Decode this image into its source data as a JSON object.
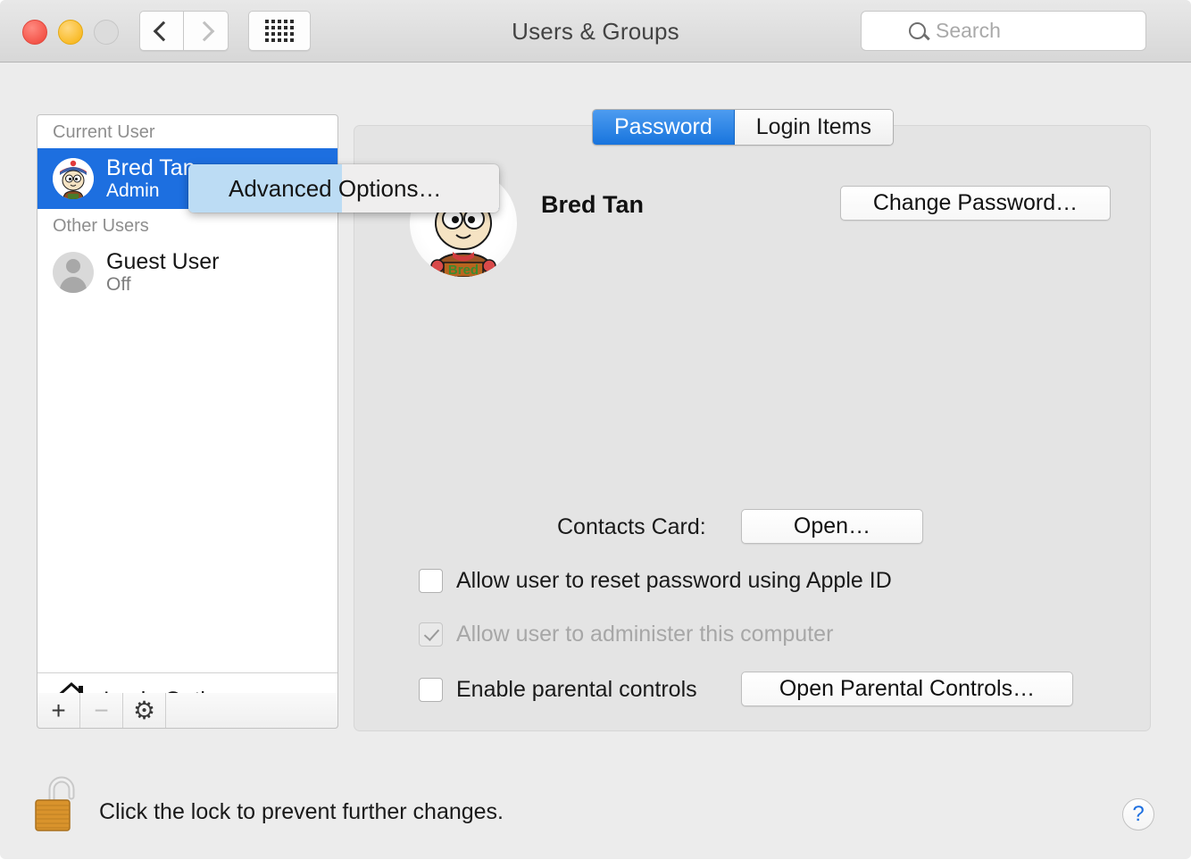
{
  "window": {
    "title": "Users & Groups",
    "traffic_lights": [
      "close",
      "minimize",
      "zoom"
    ]
  },
  "toolbar": {
    "back_icon": "chevron-left-icon",
    "forward_icon": "chevron-right-icon",
    "grid_icon": "show-all-grid-icon",
    "search": {
      "placeholder": "Search",
      "value": "",
      "icon": "search-icon"
    }
  },
  "sidebar": {
    "groups": [
      {
        "header": "Current User",
        "users": [
          {
            "name": "Bred Tan",
            "status": "Admin",
            "selected": true,
            "avatar": "bred-cartoon-avatar"
          }
        ]
      },
      {
        "header": "Other Users",
        "users": [
          {
            "name": "Guest User",
            "status": "Off",
            "selected": false,
            "avatar": "generic-person-avatar"
          }
        ]
      }
    ],
    "login_options": {
      "label": "Login Options",
      "icon": "home-icon"
    },
    "toolbar_buttons": [
      {
        "name": "add-user",
        "glyph": "+",
        "enabled": true
      },
      {
        "name": "remove-user",
        "glyph": "−",
        "enabled": false
      },
      {
        "name": "settings",
        "glyph": "⚙",
        "enabled": true
      }
    ]
  },
  "context_menu": {
    "items": [
      {
        "label": "Advanced Options…",
        "highlighted": true
      }
    ]
  },
  "main": {
    "tabs": [
      {
        "label": "Password",
        "active": true
      },
      {
        "label": "Login Items",
        "active": false
      }
    ],
    "avatar": "bred-cartoon-avatar",
    "display_name": "Bred Tan",
    "change_password_button": "Change Password…",
    "contacts_card": {
      "label": "Contacts Card:",
      "button": "Open…"
    },
    "checkboxes": [
      {
        "label": "Allow user to reset password using Apple ID",
        "checked": false,
        "disabled": false
      },
      {
        "label": "Allow user to administer this computer",
        "checked": true,
        "disabled": true
      },
      {
        "label": "Enable parental controls",
        "checked": false,
        "disabled": false
      }
    ],
    "parental_controls_button": "Open Parental Controls…"
  },
  "footer": {
    "lock_icon": "unlocked-padlock-icon",
    "lock_message": "Click the lock to prevent further changes.",
    "help_button": "?"
  },
  "colors": {
    "accent_blue": "#1d6fe0",
    "selection_blue": "#1d6fe0",
    "menu_highlight": "#bcdcf4",
    "window_bg": "#ececec",
    "panel_bg": "#e4e4e4",
    "lock_gold": "#d9932c"
  }
}
